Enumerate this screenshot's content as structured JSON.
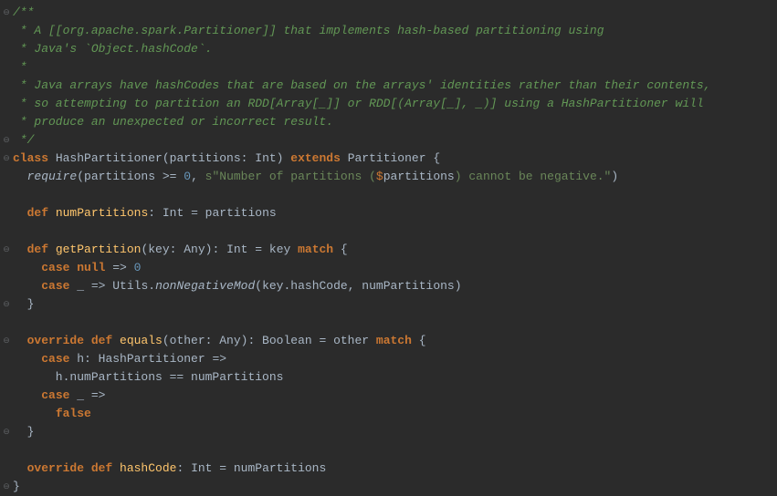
{
  "code": {
    "lines": [
      {
        "fold": "open",
        "tokens": [
          {
            "c": "doc-comment",
            "t": "/**"
          }
        ]
      },
      {
        "fold": "",
        "tokens": [
          {
            "c": "doc-comment",
            "t": " * A [[org.apache.spark.Partitioner]] that implements hash-based partitioning using"
          }
        ]
      },
      {
        "fold": "",
        "tokens": [
          {
            "c": "doc-comment",
            "t": " * Java's `Object.hashCode`."
          }
        ]
      },
      {
        "fold": "",
        "tokens": [
          {
            "c": "doc-comment",
            "t": " *"
          }
        ]
      },
      {
        "fold": "",
        "tokens": [
          {
            "c": "doc-comment",
            "t": " * Java arrays have hashCodes that are based on the arrays' identities rather than their contents,"
          }
        ]
      },
      {
        "fold": "",
        "tokens": [
          {
            "c": "doc-comment",
            "t": " * so attempting to partition an RDD[Array[_]] or RDD[(Array[_], _)] using a HashPartitioner will"
          }
        ]
      },
      {
        "fold": "",
        "tokens": [
          {
            "c": "doc-comment",
            "t": " * produce an unexpected or incorrect result."
          }
        ]
      },
      {
        "fold": "close",
        "tokens": [
          {
            "c": "doc-comment",
            "t": " */"
          }
        ]
      },
      {
        "fold": "open",
        "tokens": [
          {
            "c": "keyword",
            "t": "class "
          },
          {
            "c": "classname",
            "t": "HashPartitioner"
          },
          {
            "c": "punct",
            "t": "(partitions: "
          },
          {
            "c": "type",
            "t": "Int"
          },
          {
            "c": "punct",
            "t": ") "
          },
          {
            "c": "keyword",
            "t": "extends "
          },
          {
            "c": "classname",
            "t": "Partitioner"
          },
          {
            "c": "punct",
            "t": " {"
          }
        ]
      },
      {
        "fold": "",
        "tokens": [
          {
            "c": "text",
            "t": "  "
          },
          {
            "c": "static-call",
            "t": "require"
          },
          {
            "c": "punct",
            "t": "(partitions >= "
          },
          {
            "c": "number",
            "t": "0"
          },
          {
            "c": "punct",
            "t": ", "
          },
          {
            "c": "string",
            "t": "s\"Number of partitions ("
          },
          {
            "c": "string-interp",
            "t": "$"
          },
          {
            "c": "string-var",
            "t": "partitions"
          },
          {
            "c": "string",
            "t": ") cannot be negative.\""
          },
          {
            "c": "punct",
            "t": ")"
          }
        ]
      },
      {
        "fold": "",
        "tokens": [
          {
            "c": "text",
            "t": ""
          }
        ]
      },
      {
        "fold": "",
        "tokens": [
          {
            "c": "text",
            "t": "  "
          },
          {
            "c": "keyword",
            "t": "def "
          },
          {
            "c": "method-def",
            "t": "numPartitions"
          },
          {
            "c": "punct",
            "t": ": "
          },
          {
            "c": "type",
            "t": "Int"
          },
          {
            "c": "punct",
            "t": " = partitions"
          }
        ]
      },
      {
        "fold": "",
        "tokens": [
          {
            "c": "text",
            "t": ""
          }
        ]
      },
      {
        "fold": "open",
        "tokens": [
          {
            "c": "text",
            "t": "  "
          },
          {
            "c": "keyword",
            "t": "def "
          },
          {
            "c": "method-def",
            "t": "getPartition"
          },
          {
            "c": "punct",
            "t": "(key: Any): "
          },
          {
            "c": "type",
            "t": "Int"
          },
          {
            "c": "punct",
            "t": " = key "
          },
          {
            "c": "keyword",
            "t": "match "
          },
          {
            "c": "punct",
            "t": "{"
          }
        ]
      },
      {
        "fold": "",
        "tokens": [
          {
            "c": "text",
            "t": "    "
          },
          {
            "c": "keyword",
            "t": "case null "
          },
          {
            "c": "punct",
            "t": "=> "
          },
          {
            "c": "number",
            "t": "0"
          }
        ]
      },
      {
        "fold": "",
        "tokens": [
          {
            "c": "text",
            "t": "    "
          },
          {
            "c": "keyword",
            "t": "case "
          },
          {
            "c": "punct",
            "t": "_ => Utils."
          },
          {
            "c": "static-call",
            "t": "nonNegativeMod"
          },
          {
            "c": "punct",
            "t": "(key.hashCode, numPartitions)"
          }
        ]
      },
      {
        "fold": "close",
        "tokens": [
          {
            "c": "text",
            "t": "  "
          },
          {
            "c": "punct",
            "t": "}"
          }
        ]
      },
      {
        "fold": "",
        "tokens": [
          {
            "c": "text",
            "t": ""
          }
        ]
      },
      {
        "fold": "open",
        "tokens": [
          {
            "c": "text",
            "t": "  "
          },
          {
            "c": "keyword",
            "t": "override def "
          },
          {
            "c": "method-def",
            "t": "equals"
          },
          {
            "c": "punct",
            "t": "(other: Any): Boolean = other "
          },
          {
            "c": "keyword",
            "t": "match "
          },
          {
            "c": "punct",
            "t": "{"
          }
        ]
      },
      {
        "fold": "",
        "tokens": [
          {
            "c": "text",
            "t": "    "
          },
          {
            "c": "keyword",
            "t": "case "
          },
          {
            "c": "punct",
            "t": "h: HashPartitioner =>"
          }
        ]
      },
      {
        "fold": "",
        "tokens": [
          {
            "c": "text",
            "t": "      h.numPartitions == numPartitions"
          }
        ]
      },
      {
        "fold": "",
        "tokens": [
          {
            "c": "text",
            "t": "    "
          },
          {
            "c": "keyword",
            "t": "case "
          },
          {
            "c": "punct",
            "t": "_ =>"
          }
        ]
      },
      {
        "fold": "",
        "tokens": [
          {
            "c": "text",
            "t": "      "
          },
          {
            "c": "keyword",
            "t": "false"
          }
        ]
      },
      {
        "fold": "close",
        "tokens": [
          {
            "c": "text",
            "t": "  "
          },
          {
            "c": "punct",
            "t": "}"
          }
        ]
      },
      {
        "fold": "",
        "tokens": [
          {
            "c": "text",
            "t": ""
          }
        ]
      },
      {
        "fold": "",
        "tokens": [
          {
            "c": "text",
            "t": "  "
          },
          {
            "c": "keyword",
            "t": "override def "
          },
          {
            "c": "method-def",
            "t": "hashCode"
          },
          {
            "c": "punct",
            "t": ": "
          },
          {
            "c": "type",
            "t": "Int"
          },
          {
            "c": "punct",
            "t": " = numPartitions"
          }
        ]
      },
      {
        "fold": "close",
        "tokens": [
          {
            "c": "punct",
            "t": "}"
          }
        ]
      }
    ]
  }
}
